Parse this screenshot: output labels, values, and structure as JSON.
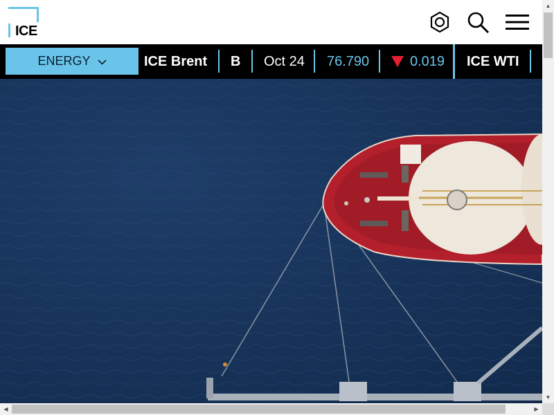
{
  "header": {
    "logo_text": "ICE",
    "icons": [
      "hexagon-settings-icon",
      "search-icon",
      "hamburger-menu-icon"
    ]
  },
  "ticker": {
    "category_label": "ENERGY",
    "items": [
      {
        "name": "ICE Brent",
        "code": "B",
        "contract": "Oct 24",
        "price": "76.790",
        "change": "0.019",
        "direction": "down"
      },
      {
        "name": "ICE WTI"
      }
    ]
  },
  "colors": {
    "accent": "#6ac4e9",
    "ticker_bg": "#000000",
    "down": "#e4202e",
    "hero_sea": "#17335a",
    "ship_red": "#b3202c"
  },
  "scrollbars": {
    "up_arrow": "▲",
    "down_arrow": "▼",
    "left_arrow": "◀",
    "right_arrow": "▶"
  }
}
